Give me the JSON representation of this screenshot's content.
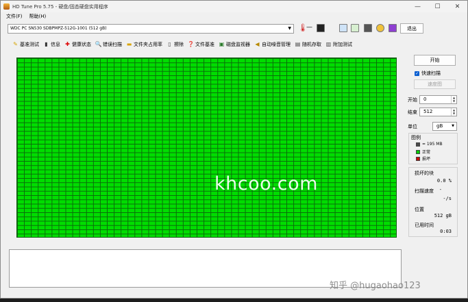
{
  "window": {
    "title": "HD Tune Pro 5.75 - 硬盘/固态硬盘实用程序",
    "minimize": "—",
    "maximize": "☐",
    "close": "✕"
  },
  "menu": [
    "文件(F)",
    "帮助(H)"
  ],
  "drive": {
    "selected": "WDC PC SN530 SDBPMPZ-512G-1001 (512 gB)",
    "temperature": "—",
    "exit_label": "退出"
  },
  "toolbar_icons": [
    "copy-icon",
    "copy-info-icon",
    "screenshot-icon",
    "options-icon",
    "save-icon"
  ],
  "tabs": [
    {
      "label": "基准测试",
      "icon": "benchmark-icon"
    },
    {
      "label": "信息",
      "icon": "info-icon"
    },
    {
      "label": "健康状态",
      "icon": "health-icon"
    },
    {
      "label": "错误扫描",
      "icon": "error-scan-icon"
    },
    {
      "label": "文件夹占用率",
      "icon": "folder-icon"
    },
    {
      "label": "擦除",
      "icon": "erase-icon"
    },
    {
      "label": "文件基准",
      "icon": "file-benchmark-icon"
    },
    {
      "label": "磁盘监视器",
      "icon": "disk-monitor-icon"
    },
    {
      "label": "自动噪音管理",
      "icon": "speaker-icon"
    },
    {
      "label": "随机存取",
      "icon": "random-access-icon"
    },
    {
      "label": "附加测试",
      "icon": "extra-tests-icon"
    }
  ],
  "scan": {
    "grid_status": "all blocks ok",
    "grid_color": "#00dd00"
  },
  "side": {
    "start_button": "开始",
    "quick_scan_label": "快速扫描",
    "quick_scan_checked": true,
    "speed_button": "速度图",
    "start_label": "开始",
    "start_value": "0",
    "end_label": "结束",
    "end_value": "512",
    "unit_label": "单位",
    "unit_value": "gB",
    "legend_title": "图例",
    "legend": [
      {
        "label": "= 195 MB",
        "color": "#4a4a4a"
      },
      {
        "label": "正常",
        "color": "#00cc00"
      },
      {
        "label": "损坏",
        "color": "#cc0000"
      }
    ],
    "stats": {
      "damaged_label": "损坏的块",
      "damaged_value": "0.0 %",
      "speed_label": "扫描速度",
      "speed_value": "-",
      "speed_unit": "-/s",
      "position_label": "位置",
      "position_value": "512 gB",
      "elapsed_label": "已用时间",
      "elapsed_value": "0:03"
    }
  },
  "watermark": "khcoo.com",
  "overlay_text": "知乎 @hugaohao123"
}
